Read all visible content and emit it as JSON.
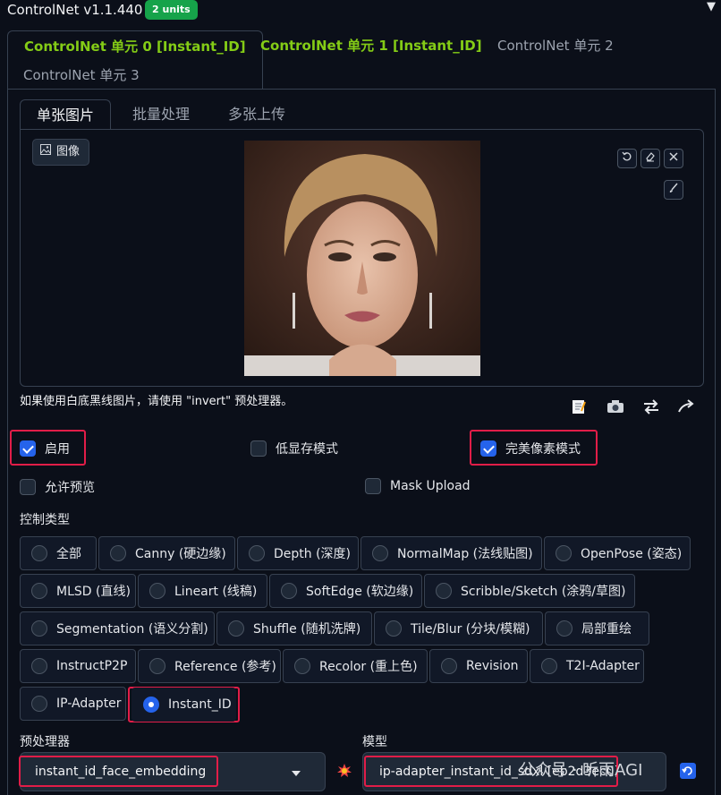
{
  "header": {
    "title": "ControlNet v1.1.440",
    "badge": "2 units",
    "collapse_icon": "▼"
  },
  "unit_tabs": [
    {
      "label": "ControlNet 单元 0 [Instant_ID]"
    },
    {
      "label": "ControlNet 单元 1 [Instant_ID]"
    },
    {
      "label": "ControlNet 单元 2"
    },
    {
      "label": "ControlNet 单元 3"
    }
  ],
  "image_tabs": [
    {
      "label": "单张图片"
    },
    {
      "label": "批量处理"
    },
    {
      "label": "多张上传"
    }
  ],
  "image_panel": {
    "label": "图像",
    "hint": "如果使用白底黑线图片，请使用 \"invert\" 预处理器。"
  },
  "options": {
    "enable": "启用",
    "low_vram": "低显存模式",
    "pixel_perfect": "完美像素模式",
    "allow_preview": "允许预览",
    "mask_upload": "Mask Upload"
  },
  "control_type": {
    "label": "控制类型",
    "items": [
      {
        "label": "全部"
      },
      {
        "label": "Canny (硬边缘)"
      },
      {
        "label": "Depth (深度)"
      },
      {
        "label": "NormalMap (法线贴图)"
      },
      {
        "label": "OpenPose (姿态)"
      },
      {
        "label": "MLSD (直线)"
      },
      {
        "label": "Lineart (线稿)"
      },
      {
        "label": "SoftEdge (软边缘)"
      },
      {
        "label": "Scribble/Sketch (涂鸦/草图)"
      },
      {
        "label": "Segmentation (语义分割)"
      },
      {
        "label": "Shuffle (随机洗牌)"
      },
      {
        "label": "Tile/Blur (分块/模糊)"
      },
      {
        "label": "局部重绘"
      },
      {
        "label": "InstructP2P"
      },
      {
        "label": "Reference (参考)"
      },
      {
        "label": "Recolor (重上色)"
      },
      {
        "label": "Revision"
      },
      {
        "label": "T2I-Adapter"
      },
      {
        "label": "IP-Adapter"
      },
      {
        "label": "Instant_ID"
      }
    ],
    "selected": "Instant_ID"
  },
  "preprocessor": {
    "label": "预处理器",
    "value": "instant_id_face_embedding"
  },
  "model": {
    "label": "模型",
    "value": "ip-adapter_instant_id_sdxl [eb2d3ec0]"
  },
  "watermark": "公众号 · 听雨AGI",
  "colors": {
    "background": "#0b0f19",
    "accent_green": "#84cc16",
    "checkbox_blue": "#2563eb",
    "highlight_red": "#e11d48"
  }
}
